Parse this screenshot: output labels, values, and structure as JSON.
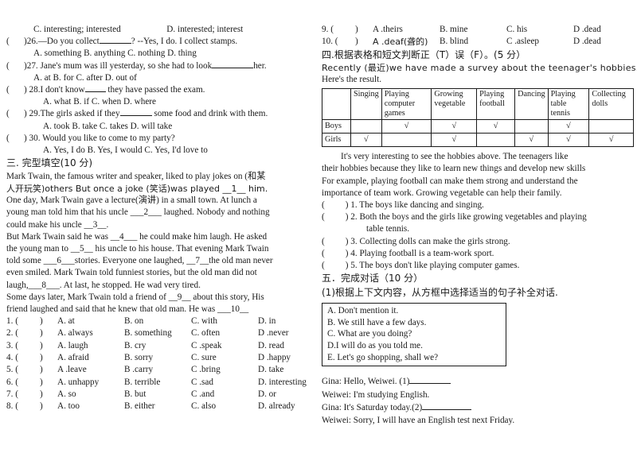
{
  "document": {
    "title": "English Exam Paper — Sections III, IV, V"
  },
  "left_column": {
    "q25_options_tail": "C. interesting; interested",
    "q25_options_tail_d": "D. interested; interest",
    "questions": [
      {
        "stem": ")26.—Do you collect",
        "stem_tail": "?   --Yes, I do. I collect stamps.",
        "options": "A. something          B. anything      C. nothing       D. thing"
      },
      {
        "stem": ")27. Jane's mum was ill yesterday, so she had to look",
        "stem_tail": "her.",
        "options": "A. at            B. for            C. after           D. out of"
      },
      {
        "stem": ") 28.I don't know",
        "stem_tail": "they have passed the exam.",
        "options": "A. what    B. if       C. when    D. where"
      },
      {
        "stem": ") 29.The girls asked if they",
        "stem_tail": "some food and drink with them.",
        "options": "A. took          B. take          C. takes    D. will take"
      },
      {
        "stem": ") 30. Would you like to come to my party?",
        "stem_tail": "",
        "options": "A. Yes, I do      B. Yes, I would       C. Yes, I'd love to"
      }
    ],
    "section3_heading": "三. 完型填空(10 分)",
    "passage": [
      "Mark Twain, the famous writer and speaker, liked to play jokes on (和某",
      "人开玩笑)others But once a joke (笑话)was played __1__ him.",
      "One day, Mark Twain gave a lecture(演讲) in a small town. At lunch a",
      "young man told him that his uncle ___2___ laughed. Nobody and nothing",
      "could make his uncle __3__.",
      "But Mark Twain said he was __4___ he could make him laugh. He asked",
      "the young man to __5__ his uncle to his house. That evening Mark Twain",
      "told some ___6___stories. Everyone one laughed, __7__the old man never",
      "even smiled. Mark Twain told funniest stories, but the old man did not",
      "laugh,___8___. At last, he stopped. He wad very tired.",
      "Some days later, Mark Twain told a friend of __9__ about this story, His",
      "friend laughed and said that he knew that old man. He was ___10__"
    ],
    "cloze_answers": [
      {
        "num": "1. (",
        "par": ")",
        "a": "A. at",
        "b": "B. on",
        "c": "C. with",
        "d": "D. in"
      },
      {
        "num": "2. (",
        "par": ")",
        "a": "A. always",
        "b": "B. something",
        "c": "C. often",
        "d": "D .never"
      },
      {
        "num": "3. (",
        "par": ")",
        "a": "A. laugh",
        "b": "B. cry",
        "c": "C .speak",
        "d": "D. read"
      },
      {
        "num": "4. (",
        "par": ")",
        "a": "A. afraid",
        "b": "B. sorry",
        "c": "C. sure",
        "d": "D .happy"
      },
      {
        "num": "5. (",
        "par": ")",
        "a": "A .leave",
        "b": "B .carry",
        "c": "C .bring",
        "d": "D. take"
      },
      {
        "num": "6. (",
        "par": ")",
        "a": "A. unhappy",
        "b": "B. terrible",
        "c": "C .sad",
        "d": "D. interesting"
      },
      {
        "num": "7. (",
        "par": ")",
        "a": "A. so",
        "b": "B. but",
        "c": "C .and",
        "d": "D. or"
      },
      {
        "num": "8. (",
        "par": ")",
        "a": "A. too",
        "b": "B. either",
        "c": "C. also",
        "d": "D. already"
      }
    ]
  },
  "right_column": {
    "cloze_answers_cont": [
      {
        "num": "9. (",
        "par": ")",
        "a": "A .theirs",
        "b": "B. mine",
        "c": "C. his",
        "d": "D .dead"
      },
      {
        "num": "10. (",
        "par": ")",
        "a": "A .deaf(聋的)",
        "b": "B. blind",
        "c": "C .asleep",
        "d": "D .dead"
      }
    ],
    "section4_heading": "四.根据表格和短文判断正（T）误（F）。(5 分）",
    "intro": [
      "Recently (最近)we have made a survey about the teenager's hobbies.",
      "Here's the result."
    ],
    "survey_table": {
      "corner": "",
      "columns": [
        "Singing",
        "Playing computer games",
        "Growing vegetable",
        "Playing football",
        "Dancing",
        "Playing table tennis",
        "Collecting dolls"
      ],
      "tick_glyph": "√",
      "rows": [
        {
          "label": "Boys",
          "marks": [
            "",
            "√",
            "√",
            "√",
            "",
            "√",
            ""
          ]
        },
        {
          "label": "Girls",
          "marks": [
            "√",
            "",
            "√",
            "",
            "√",
            "√",
            "√"
          ]
        }
      ]
    },
    "reading_passage": [
      "It's very interesting to see the hobbies above. The teenagers like",
      "their hobbies because they like to learn new things and develop new skills",
      "For example, playing football can make them strong and understand the",
      "importance of team work. Growing vegetable can help their family."
    ],
    "tf_statements": [
      {
        "par_open": "(",
        "par_close": ")",
        "text": "1. The boys like dancing and singing.",
        "cont": ""
      },
      {
        "par_open": "(",
        "par_close": ")",
        "text": "2. Both the boys and the girls like growing vegetables and playing",
        "cont": "table tennis."
      },
      {
        "par_open": "(",
        "par_close": ")",
        "text": "3. Collecting dolls can make the girls strong.",
        "cont": ""
      },
      {
        "par_open": "(",
        "par_close": ")",
        "text": "4. Playing football is a team-work sport.",
        "cont": ""
      },
      {
        "par_open": "(",
        "par_close": ")",
        "text": "5. The boys don't like playing computer games.",
        "cont": ""
      }
    ],
    "section5_heading": "五．完成对话（10 分）",
    "section5_instruction": "(1)根据上下文内容，从方框中选择适当的句子补全对话.",
    "choice_box": [
      "A. Don't mention it.",
      "B. We still have a few days.",
      "C. What are you doing?",
      "D.I will do as you told me.",
      "E. Let's go shopping, shall we?"
    ],
    "dialogue": [
      {
        "speaker": "Gina:",
        "text": "Hello, Weiwei. (1)",
        "blank": true
      },
      {
        "speaker": "Weiwei:",
        "text": "  I'm studying English.",
        "blank": false
      },
      {
        "speaker": "Gina:",
        "text": "It's Saturday today.(2)",
        "blank": true
      },
      {
        "speaker": "Weiwei:",
        "text": "Sorry, I will have an English test next Friday.",
        "blank": false
      }
    ]
  }
}
